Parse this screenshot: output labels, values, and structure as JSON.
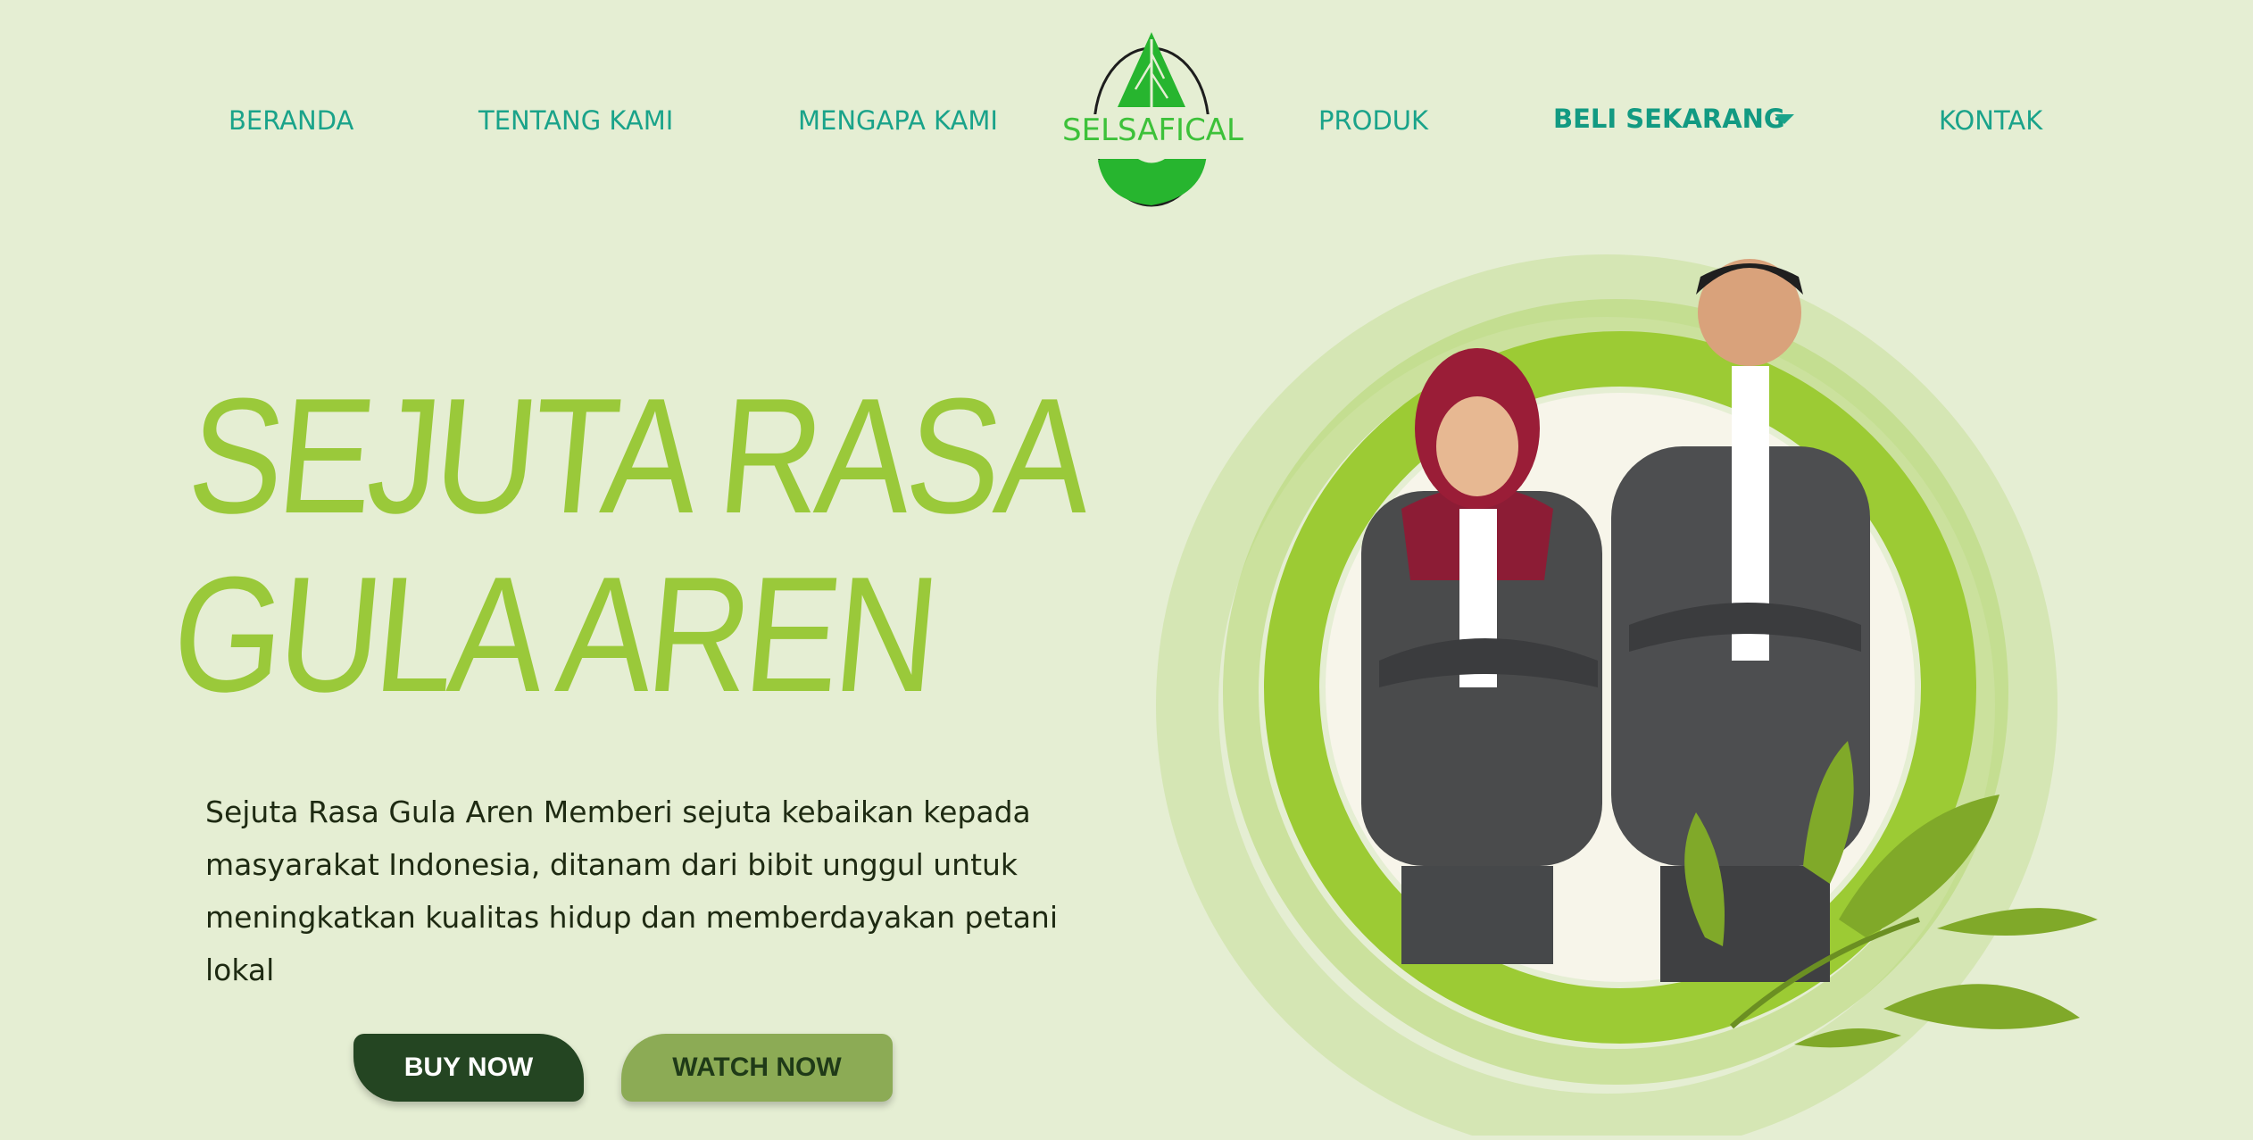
{
  "nav": {
    "items": [
      "BERANDA",
      "TENTANG KAMI",
      "MENGAPA KAMI",
      "PRODUK",
      "BELI SEKARANG",
      "KONTAK"
    ],
    "active_item": "BELI SEKARANG"
  },
  "logo": {
    "text": "SELSAFICAL"
  },
  "hero": {
    "title_line1": "SEJUTA RASA",
    "title_line2": "GULA AREN",
    "description": "Sejuta Rasa Gula Aren Memberi sejuta kebaikan kepada masyarakat Indonesia, ditanam dari bibit unggul untuk meningkatkan kualitas hidup dan memberdayakan petani lokal",
    "buy_button": "BUY NOW",
    "watch_button": "WATCH NOW"
  },
  "colors": {
    "background": "#e5eed3",
    "nav_text": "#1aa38a",
    "title_green": "#9ac93a",
    "buy_button": "#244522",
    "watch_button": "#8cab55"
  }
}
